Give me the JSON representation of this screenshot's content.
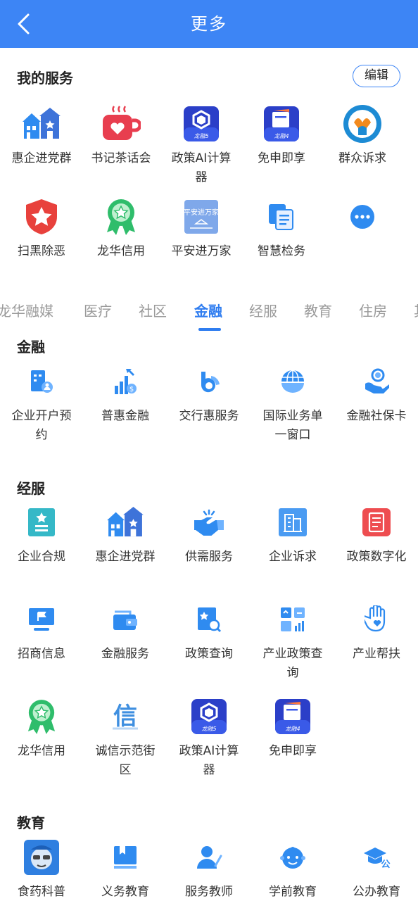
{
  "header": {
    "title": "更多"
  },
  "my_services": {
    "title": "我的服务",
    "edit_label": "编辑",
    "items": [
      {
        "label": "惠企进党群",
        "icon": "buildings-icon"
      },
      {
        "label": "书记茶话会",
        "icon": "coffee-cup-icon"
      },
      {
        "label": "政策AI计算器",
        "icon": "longrong5-app-icon"
      },
      {
        "label": "免申即享",
        "icon": "longrong4-app-icon"
      },
      {
        "label": "群众诉求",
        "icon": "appeal-emblem-icon"
      },
      {
        "label": "扫黑除恶",
        "icon": "shield-star-icon"
      },
      {
        "label": "龙华信用",
        "icon": "credit-badge-icon"
      },
      {
        "label": "平安进万家",
        "icon": "pingan-logo-icon",
        "logo_text": "平安进万家"
      },
      {
        "label": "智慧检务",
        "icon": "document-icon"
      },
      {
        "label": "",
        "icon": "more-icon"
      }
    ]
  },
  "tabs": [
    {
      "label": "龙华融媒",
      "active": false
    },
    {
      "label": "医疗",
      "active": false
    },
    {
      "label": "社区",
      "active": false
    },
    {
      "label": "金融",
      "active": true
    },
    {
      "label": "经服",
      "active": false
    },
    {
      "label": "教育",
      "active": false
    },
    {
      "label": "住房",
      "active": false
    },
    {
      "label": "其",
      "active": false
    }
  ],
  "finance": {
    "title": "金融",
    "items": [
      {
        "label": "企业开户预约",
        "icon": "account-open-icon"
      },
      {
        "label": "普惠金融",
        "icon": "coins-chart-icon"
      },
      {
        "label": "交行惠服务",
        "icon": "bocom-logo-icon"
      },
      {
        "label": "国际业务单一窗口",
        "icon": "globe-icon"
      },
      {
        "label": "金融社保卡",
        "icon": "hand-user-icon"
      }
    ]
  },
  "business": {
    "title": "经服",
    "items": [
      {
        "label": "企业合规",
        "icon": "compliance-book-icon"
      },
      {
        "label": "惠企进党群",
        "icon": "buildings-icon"
      },
      {
        "label": "供需服务",
        "icon": "handshake-icon"
      },
      {
        "label": "企业诉求",
        "icon": "office-building-icon"
      },
      {
        "label": "政策数字化",
        "icon": "digital-doc-icon"
      },
      {
        "label": "招商信息",
        "icon": "monitor-flag-icon"
      },
      {
        "label": "金融服务",
        "icon": "wallet-icon"
      },
      {
        "label": "政策查询",
        "icon": "doc-search-icon"
      },
      {
        "label": "产业政策查询",
        "icon": "dashboard-icon"
      },
      {
        "label": "产业帮扶",
        "icon": "hand-heart-icon"
      },
      {
        "label": "龙华信用",
        "icon": "credit-badge-icon"
      },
      {
        "label": "诚信示范街区",
        "icon": "xin-character-icon",
        "logo_text": "信"
      },
      {
        "label": "政策AI计算器",
        "icon": "longrong5-app-icon"
      },
      {
        "label": "免申即享",
        "icon": "longrong4-app-icon"
      }
    ]
  },
  "education": {
    "title": "教育",
    "items": [
      {
        "label": "食药科普",
        "icon": "mascot-icon"
      },
      {
        "label": "义务教育",
        "icon": "book-icon"
      },
      {
        "label": "服务教师",
        "icon": "teacher-icon"
      },
      {
        "label": "学前教育",
        "icon": "child-face-icon"
      },
      {
        "label": "公办教育",
        "icon": "grad-cap-icon",
        "logo_text": "公"
      }
    ]
  },
  "colors": {
    "header": "#3d85f5",
    "accent": "#2f7df0",
    "icon_blue": "#2f8bf0",
    "tab_inactive": "#9a9a9a"
  }
}
